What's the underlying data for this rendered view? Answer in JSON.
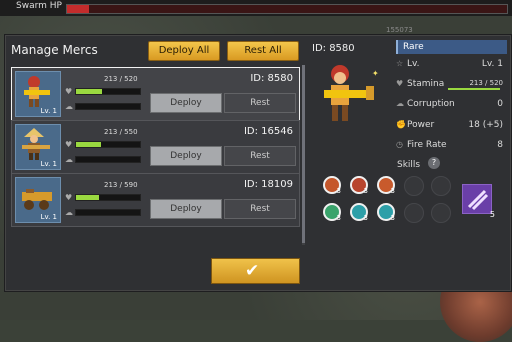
{
  "hud": {
    "hp_label": "Swarm HP",
    "hp_fraction": 0.05,
    "ghost_text": "155073"
  },
  "panel": {
    "title": "Manage Mercs",
    "deploy_all": "Deploy All",
    "rest_all": "Rest All"
  },
  "mercs": [
    {
      "id": "ID: 8580",
      "level": "Lv. 1",
      "hp": "213 / 520",
      "hp_fraction": 0.41,
      "stamina_fraction": 0.0,
      "deploy": "Deploy",
      "rest": "Rest",
      "selected": true,
      "icon": "gunner-red-icon"
    },
    {
      "id": "ID: 16546",
      "level": "Lv. 1",
      "hp": "213 / 550",
      "hp_fraction": 0.39,
      "stamina_fraction": 0.0,
      "deploy": "Deploy",
      "rest": "Rest",
      "selected": false,
      "icon": "gunner-straw-hat-icon"
    },
    {
      "id": "ID: 18109",
      "level": "Lv. 1",
      "hp": "213 / 590",
      "hp_fraction": 0.36,
      "stamina_fraction": 0.0,
      "deploy": "Deploy",
      "rest": "Rest",
      "selected": false,
      "icon": "cannon-icon"
    }
  ],
  "detail": {
    "id": "ID: 8580",
    "rarity": "Rare",
    "stats": [
      {
        "icon": "star-icon",
        "label": "Lv.",
        "value": "Lv. 1"
      },
      {
        "icon": "heart-icon",
        "label": "Stamina",
        "value": "213 / 520"
      },
      {
        "icon": "corruption-icon",
        "label": "Corruption",
        "value": "0"
      },
      {
        "icon": "power-icon",
        "label": "Power",
        "value": "18 (+5)"
      },
      {
        "icon": "fire-rate-icon",
        "label": "Fire Rate",
        "value": "8"
      }
    ],
    "skills_label": "Skills",
    "help": "?",
    "skills": [
      {
        "icon": "flex-icon",
        "count": "3",
        "color": "#c5572b"
      },
      {
        "icon": "spider-icon",
        "count": "3",
        "color": "#b8452e"
      },
      {
        "icon": "fist-icon",
        "count": "3",
        "color": "#c85a2c"
      },
      {
        "icon": "empty",
        "count": "",
        "color": ""
      },
      {
        "icon": "empty",
        "count": "",
        "color": ""
      },
      {
        "icon": "shield-heal-icon",
        "count": "3",
        "color": "#3aa36b"
      },
      {
        "icon": "swirl-icon",
        "count": "3",
        "color": "#2d9fa8"
      },
      {
        "icon": "swirl-icon",
        "count": "3",
        "color": "#2d9fa8"
      },
      {
        "icon": "empty",
        "count": "",
        "color": ""
      },
      {
        "icon": "empty",
        "count": "",
        "color": ""
      }
    ],
    "special_skill": {
      "icon": "slash-icon",
      "count": "5"
    }
  },
  "confirm": {
    "icon": "checkmark-icon",
    "glyph": "✔"
  }
}
